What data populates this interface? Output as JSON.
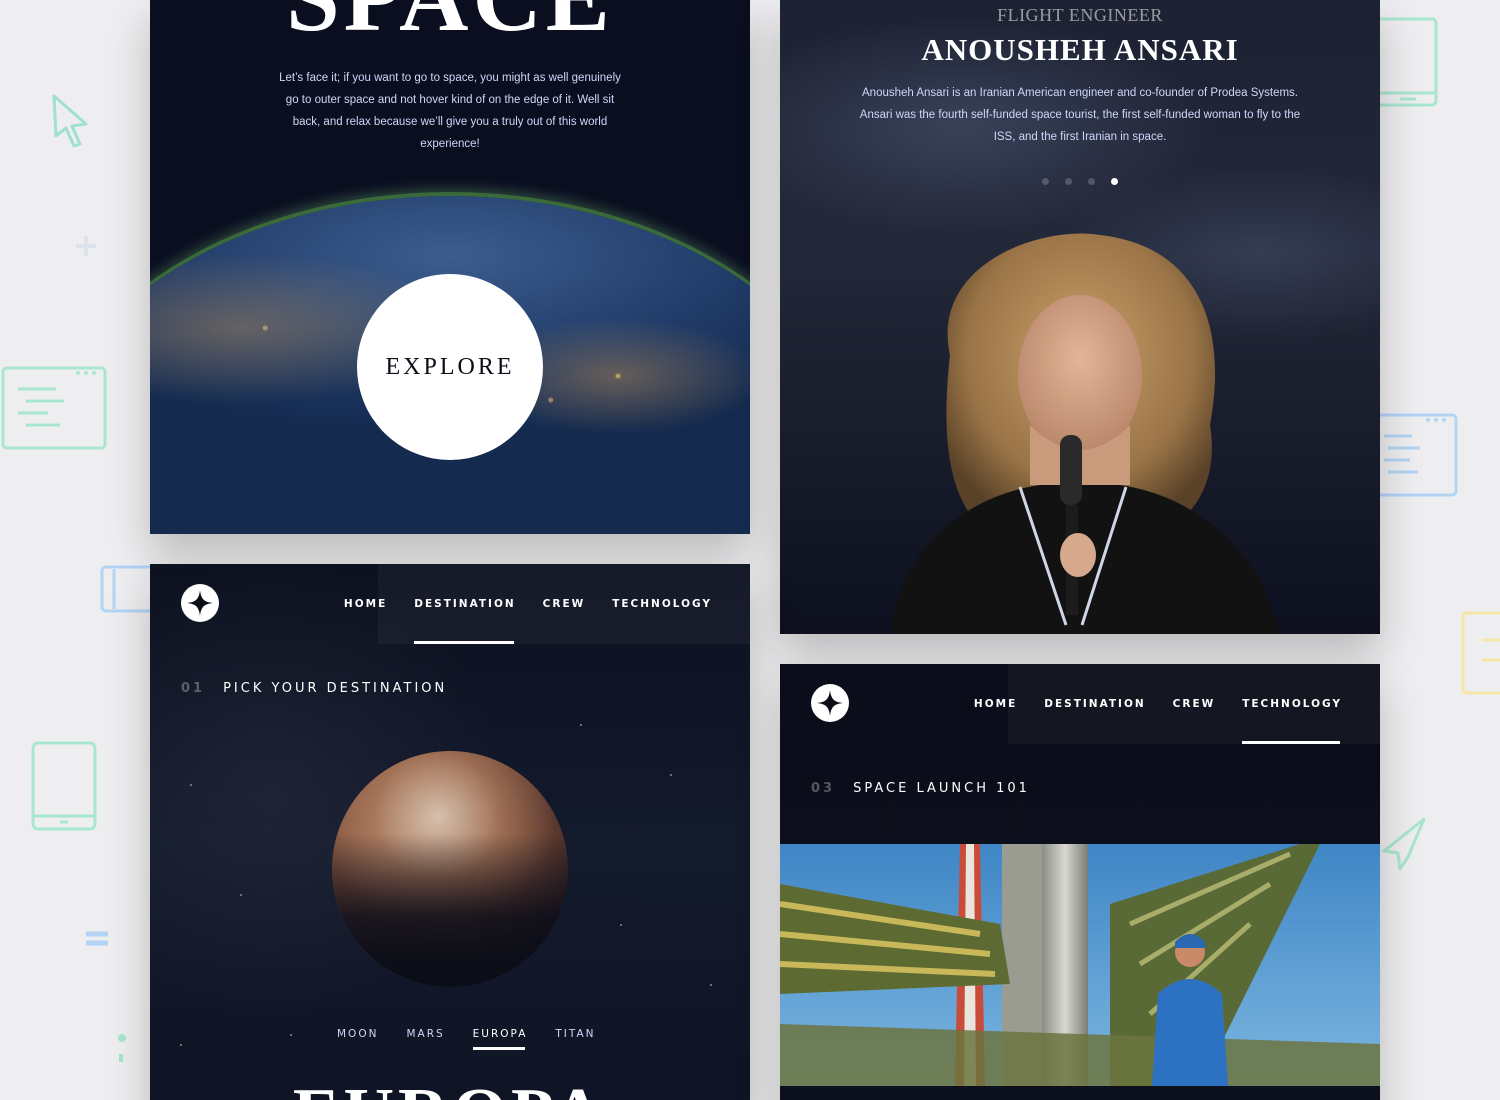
{
  "home": {
    "title": "SPACE",
    "intro": "Let’s face it; if you want to go to space, you might as well genuinely go to outer space and not hover kind of on the edge of it. Well sit back, and relax because we’ll give you a truly out of this world experience!",
    "explore_label": "EXPLORE"
  },
  "crew": {
    "role": "FLIGHT ENGINEER",
    "name": "ANOUSHEH ANSARI",
    "bio": "Anousheh Ansari is an Iranian American engineer and co-founder of Prodea Systems. Ansari was the fourth self-funded space tourist, the first self-funded woman to fly to the ISS, and the first Iranian in space.",
    "slides_total": 4,
    "active_slide": 4
  },
  "destination_page": {
    "nav": [
      "HOME",
      "DESTINATION",
      "CREW",
      "TECHNOLOGY"
    ],
    "active_nav": "DESTINATION",
    "section_number": "01",
    "section_title": "PICK YOUR DESTINATION",
    "tabs": [
      "MOON",
      "MARS",
      "EUROPA",
      "TITAN"
    ],
    "active_tab": "EUROPA",
    "planet_name": "EUROPA"
  },
  "technology_page": {
    "nav": [
      "HOME",
      "DESTINATION",
      "CREW",
      "TECHNOLOGY"
    ],
    "active_nav": "TECHNOLOGY",
    "section_number": "03",
    "section_title": "SPACE LAUNCH 101"
  },
  "colors": {
    "background": "#eeeef0",
    "card_dark": "#0b0d17",
    "text_light": "#d0d6f9",
    "white": "#ffffff"
  }
}
